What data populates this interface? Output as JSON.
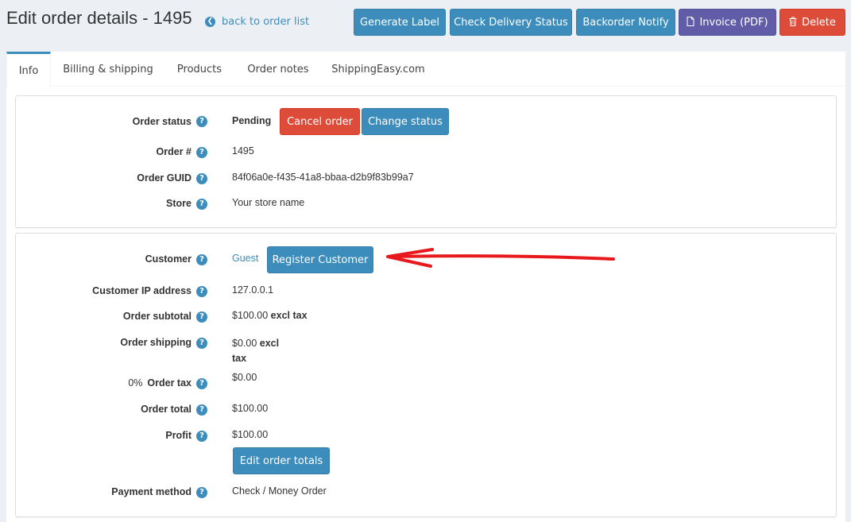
{
  "header": {
    "title": "Edit order details - 1495",
    "back_link": "back to order list",
    "buttons": {
      "generate_label": "Generate Label",
      "check_delivery": "Check Delivery Status",
      "backorder_notify": "Backorder Notify",
      "invoice": "Invoice (PDF)",
      "delete": "Delete"
    }
  },
  "tabs": [
    "Info",
    "Billing & shipping",
    "Products",
    "Order notes",
    "ShippingEasy.com"
  ],
  "order_panel": {
    "status_label": "Order status",
    "status_value": "Pending",
    "cancel_button": "Cancel order",
    "change_status_button": "Change status",
    "order_num_label": "Order #",
    "order_num_value": "1495",
    "guid_label": "Order GUID",
    "guid_value": "84f06a0e-f435-41a8-bbaa-d2b9f83b99a7",
    "store_label": "Store",
    "store_value": "Your store name"
  },
  "customer_panel": {
    "customer_label": "Customer",
    "customer_value": "Guest",
    "register_button": "Register Customer",
    "ip_label": "Customer IP address",
    "ip_value": "127.0.0.1",
    "subtotal_label": "Order subtotal",
    "subtotal_value": "$100.00",
    "subtotal_suffix": "excl tax",
    "shipping_label": "Order shipping",
    "shipping_value": "$0.00",
    "shipping_suffix_1": "excl",
    "shipping_suffix_2": "tax",
    "tax_rate": "0%",
    "tax_label": "Order tax",
    "tax_value": "$0.00",
    "total_label": "Order total",
    "total_value": "$100.00",
    "profit_label": "Profit",
    "profit_value": "$100.00",
    "edit_totals_button": "Edit order totals",
    "payment_label": "Payment method",
    "payment_value": "Check / Money Order"
  },
  "colors": {
    "primary": "#3c8dbc",
    "danger": "#dd4b39",
    "purple": "#605ca8",
    "annotation_arrow": "#e8191c"
  },
  "icons": [
    "back-circle-icon",
    "pdf-file-icon",
    "trash-icon",
    "help-icon",
    "red-arrow-annotation"
  ]
}
